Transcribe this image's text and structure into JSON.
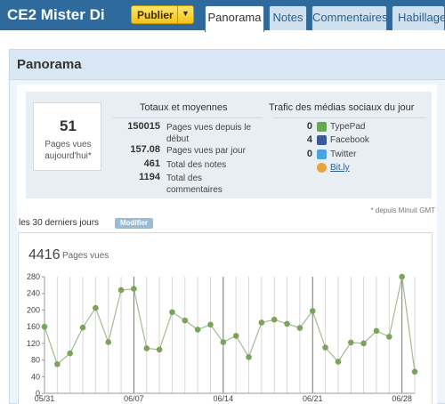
{
  "header": {
    "blog_title": "CE2 Mister Di",
    "publish_label": "Publier",
    "tabs": [
      "Panorama",
      "Notes",
      "Commentaires",
      "Habillage"
    ]
  },
  "panel": {
    "title": "Panorama"
  },
  "summary": {
    "today_count": "51",
    "today_label": "Pages vues aujourd'hui*",
    "totals_heading": "Totaux et moyennes",
    "totals": [
      {
        "value": "150015",
        "label": "Pages vues depuis le début"
      },
      {
        "value": "157.08",
        "label": "Pages vues par jour"
      },
      {
        "value": "461",
        "label": "Total des notes"
      },
      {
        "value": "1194",
        "label": "Total des commentaires"
      }
    ],
    "social_heading": "Trafic des médias sociaux du jour",
    "social": [
      {
        "value": "0",
        "label": "TypePad",
        "icon": "typepad-icon",
        "color": "#6aa84f"
      },
      {
        "value": "4",
        "label": "Facebook",
        "icon": "facebook-icon",
        "color": "#3b5998"
      },
      {
        "value": "0",
        "label": "Twitter",
        "icon": "twitter-icon",
        "color": "#4aa3df"
      },
      {
        "value": "",
        "label": "Bit.ly",
        "icon": "bitly-icon",
        "color": "#e8a33d"
      }
    ]
  },
  "gmt_note": "* depuis Minuit GMT",
  "period_label": "les 30 derniers jours",
  "modify_label": "Modifier",
  "chart_data": {
    "type": "line",
    "total": "4416",
    "unit": "Pages vues",
    "ylim": [
      0,
      280
    ],
    "yticks": [
      "0",
      "40",
      "80",
      "120",
      "160",
      "200",
      "240",
      "280"
    ],
    "x": [
      "05/31",
      "06/01",
      "06/02",
      "06/03",
      "06/04",
      "06/05",
      "06/06",
      "06/07",
      "06/08",
      "06/09",
      "06/10",
      "06/11",
      "06/12",
      "06/13",
      "06/14",
      "06/15",
      "06/16",
      "06/17",
      "06/18",
      "06/19",
      "06/20",
      "06/21",
      "06/22",
      "06/23",
      "06/24",
      "06/25",
      "06/26",
      "06/27",
      "06/28",
      "06/29"
    ],
    "xtick_labels": [
      "05/31",
      "06/07",
      "06/14",
      "06/21",
      "06/28"
    ],
    "values": [
      160,
      70,
      96,
      158,
      205,
      123,
      248,
      251,
      108,
      105,
      195,
      175,
      153,
      165,
      123,
      138,
      87,
      170,
      177,
      167,
      157,
      198,
      110,
      76,
      122,
      120,
      150,
      136,
      280,
      52
    ],
    "color": "#7aa35c",
    "grid": true
  }
}
